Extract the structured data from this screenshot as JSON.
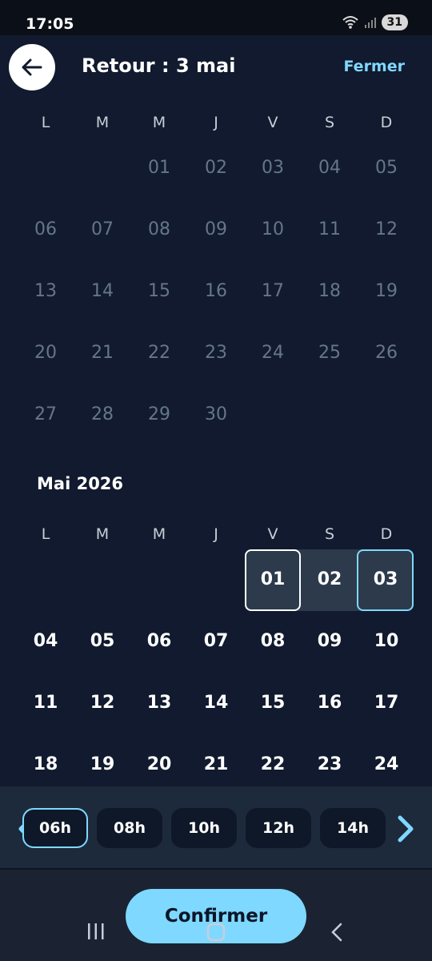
{
  "status": {
    "time": "17:05",
    "battery": "31"
  },
  "header": {
    "title": "Retour : 3 mai",
    "close_label": "Fermer"
  },
  "weekdays": [
    "L",
    "M",
    "M",
    "J",
    "V",
    "S",
    "D"
  ],
  "april": {
    "rows": [
      [
        "",
        "",
        "01",
        "02",
        "03",
        "04",
        "05"
      ],
      [
        "06",
        "07",
        "08",
        "09",
        "10",
        "11",
        "12"
      ],
      [
        "13",
        "14",
        "15",
        "16",
        "17",
        "18",
        "19"
      ],
      [
        "20",
        "21",
        "22",
        "23",
        "24",
        "25",
        "26"
      ],
      [
        "27",
        "28",
        "29",
        "30",
        "",
        "",
        ""
      ]
    ]
  },
  "may": {
    "title": "Mai 2026",
    "rows": [
      [
        "",
        "",
        "",
        "",
        "01",
        "02",
        "03"
      ],
      [
        "04",
        "05",
        "06",
        "07",
        "08",
        "09",
        "10"
      ],
      [
        "11",
        "12",
        "13",
        "14",
        "15",
        "16",
        "17"
      ],
      [
        "18",
        "19",
        "20",
        "21",
        "22",
        "23",
        "24"
      ]
    ],
    "selection": {
      "start": "01",
      "end": "03"
    }
  },
  "times": {
    "options": [
      "06h",
      "08h",
      "10h",
      "12h",
      "14h"
    ],
    "selected": "06h"
  },
  "actions": {
    "confirm_label": "Confirmer"
  }
}
